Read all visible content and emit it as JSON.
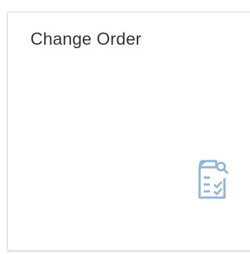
{
  "tile": {
    "title": "Change Order",
    "icon": "order-document-search-icon",
    "icon_color": "#8fb6d6",
    "text_color": "#32363a"
  }
}
